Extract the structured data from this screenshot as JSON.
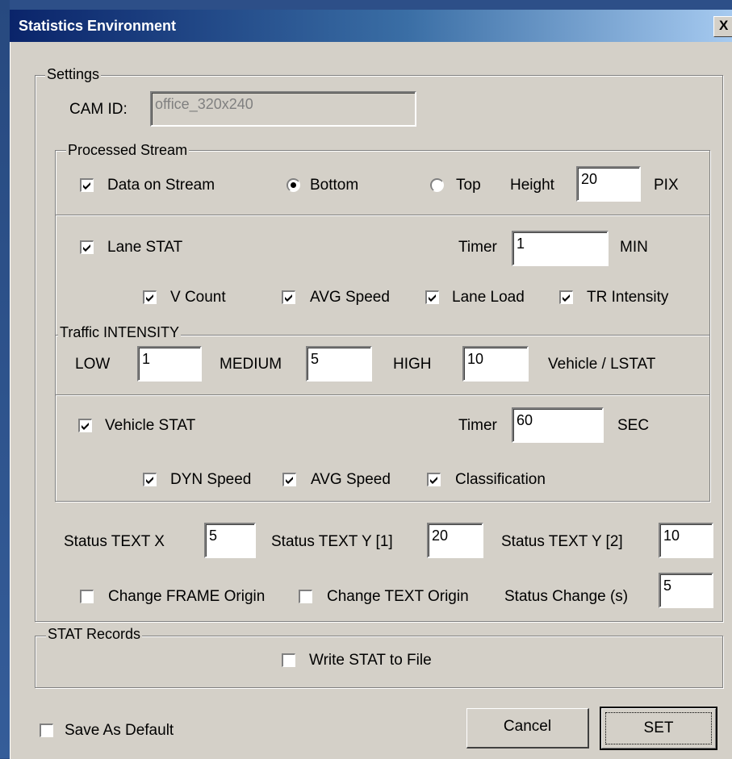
{
  "window": {
    "title": "Statistics Environment",
    "close_glyph": "X"
  },
  "settings": {
    "legend": "Settings",
    "cam_id": {
      "label": "CAM ID:",
      "value": "office_320x240"
    },
    "processed_stream": {
      "legend": "Processed Stream",
      "data_on_stream": {
        "label": "Data on Stream",
        "checked": true
      },
      "position": {
        "bottom_label": "Bottom",
        "top_label": "Top",
        "selected": "Bottom"
      },
      "height": {
        "label": "Height",
        "value": "20",
        "unit": "PIX"
      },
      "lane_stat": {
        "label": "Lane STAT",
        "checked": true,
        "timer_label": "Timer",
        "timer_value": "1",
        "timer_unit": "MIN",
        "options": [
          {
            "label": "V Count",
            "checked": true
          },
          {
            "label": "AVG Speed",
            "checked": true
          },
          {
            "label": "Lane Load",
            "checked": true
          },
          {
            "label": "TR Intensity",
            "checked": true
          }
        ]
      },
      "traffic_intensity": {
        "legend": "Traffic INTENSITY",
        "low_label": "LOW",
        "low_value": "1",
        "medium_label": "MEDIUM",
        "medium_value": "5",
        "high_label": "HIGH",
        "high_value": "10",
        "unit": "Vehicle / LSTAT"
      },
      "vehicle_stat": {
        "label": "Vehicle STAT",
        "checked": true,
        "timer_label": "Timer",
        "timer_value": "60",
        "timer_unit": "SEC",
        "options": [
          {
            "label": "DYN Speed",
            "checked": true
          },
          {
            "label": "AVG Speed",
            "checked": true
          },
          {
            "label": "Classification",
            "checked": true
          }
        ]
      }
    },
    "status_text_x": {
      "label": "Status TEXT X",
      "value": "5"
    },
    "status_text_y1": {
      "label": "Status TEXT Y [1]",
      "value": "20"
    },
    "status_text_y2": {
      "label": "Status TEXT Y [2]",
      "value": "10"
    },
    "change_frame_origin": {
      "label": "Change FRAME Origin",
      "checked": false
    },
    "change_text_origin": {
      "label": "Change TEXT Origin",
      "checked": false
    },
    "status_change": {
      "label": "Status Change (s)",
      "value": "5"
    }
  },
  "stat_records": {
    "legend": "STAT Records",
    "write_to_file": {
      "label": "Write STAT to File",
      "checked": false
    }
  },
  "footer": {
    "save_as_default": {
      "label": "Save As Default",
      "checked": false
    },
    "cancel_label": "Cancel",
    "set_label": "SET"
  },
  "colors": {
    "dialog_bg": "#d4d0c8",
    "titlebar_start": "#0a246a",
    "titlebar_end": "#a6caf0",
    "desktop": "#2d4f88"
  },
  "icons": {
    "check": "check-mark-icon",
    "close": "close-icon"
  }
}
